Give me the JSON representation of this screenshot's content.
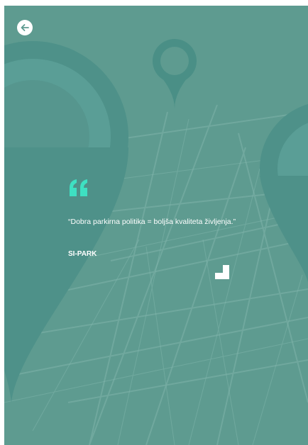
{
  "quote": {
    "text": "“Dobra parkirna politika = boljša kvaliteta življenja.”",
    "author": "SI-PARK"
  },
  "icons": {
    "back": "arrow-left-icon",
    "quote_mark": "quote-icon",
    "corner": "corner-icon",
    "pin": "map-pin-icon"
  },
  "colors": {
    "background": "#5e9b90",
    "pin": "#4a8f86",
    "accent": "#3ee0c2",
    "text": "#ffffff"
  }
}
